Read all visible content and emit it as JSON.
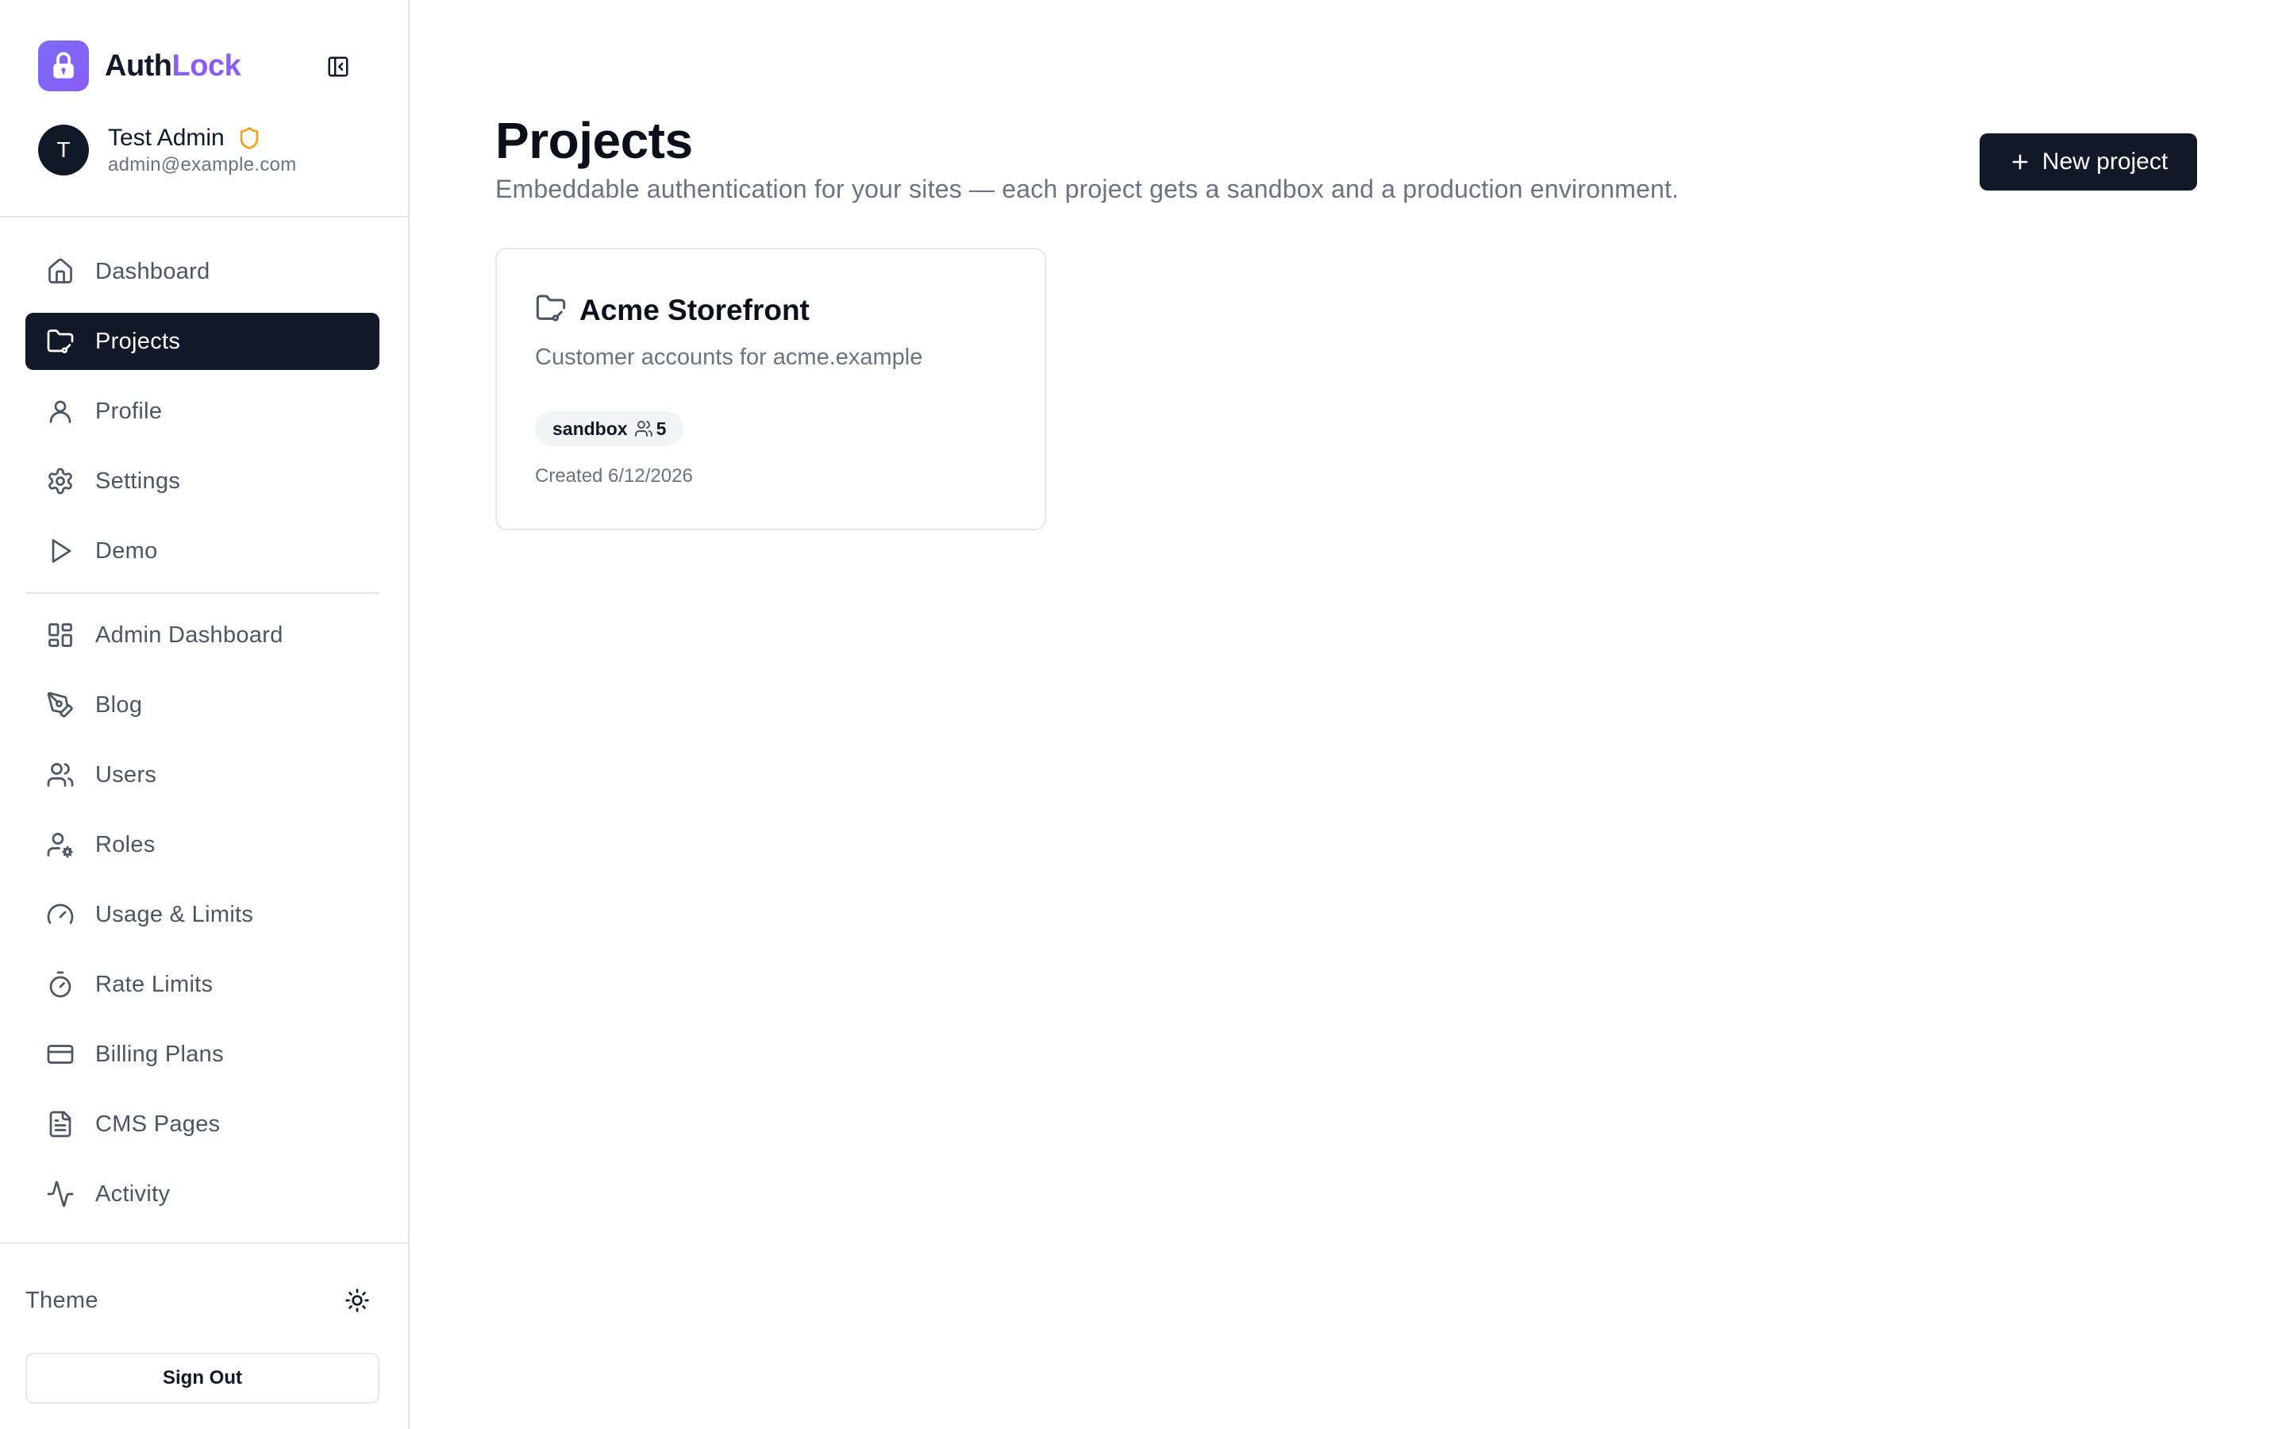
{
  "app": {
    "brand_part1": "Auth",
    "brand_part2": "Lock",
    "brand_color": "#8b5cf6"
  },
  "user": {
    "initial": "T",
    "name": "Test Admin",
    "email": "admin@example.com",
    "badge_icon": "shield-icon",
    "badge_color": "#f59e0b"
  },
  "sidebar": {
    "items": [
      {
        "label": "Dashboard",
        "icon": "home-icon"
      },
      {
        "label": "Projects",
        "icon": "folder-icon",
        "active": true
      },
      {
        "label": "Profile",
        "icon": "user-icon"
      },
      {
        "label": "Settings",
        "icon": "gear-icon"
      },
      {
        "label": "Demo",
        "icon": "play-icon"
      }
    ],
    "admin_items": [
      {
        "label": "Admin Dashboard",
        "icon": "layout-grid-icon"
      },
      {
        "label": "Blog",
        "icon": "pen-tool-icon"
      },
      {
        "label": "Users",
        "icon": "users-icon"
      },
      {
        "label": "Roles",
        "icon": "user-cog-icon"
      },
      {
        "label": "Usage & Limits",
        "icon": "gauge-icon"
      },
      {
        "label": "Rate Limits",
        "icon": "timer-icon"
      },
      {
        "label": "Billing Plans",
        "icon": "credit-card-icon"
      },
      {
        "label": "CMS Pages",
        "icon": "file-text-icon"
      },
      {
        "label": "Activity",
        "icon": "activity-icon"
      }
    ],
    "theme_label": "Theme",
    "sign_out_label": "Sign Out"
  },
  "main": {
    "title": "Projects",
    "subtitle": "Embeddable authentication for your sites — each project gets a sandbox and a production environment.",
    "new_button_label": "New project",
    "projects": [
      {
        "name": "Acme Storefront",
        "description": "Customer accounts for acme.example",
        "environment": "sandbox",
        "user_count": "5",
        "created": "Created 6/12/2026"
      }
    ]
  }
}
